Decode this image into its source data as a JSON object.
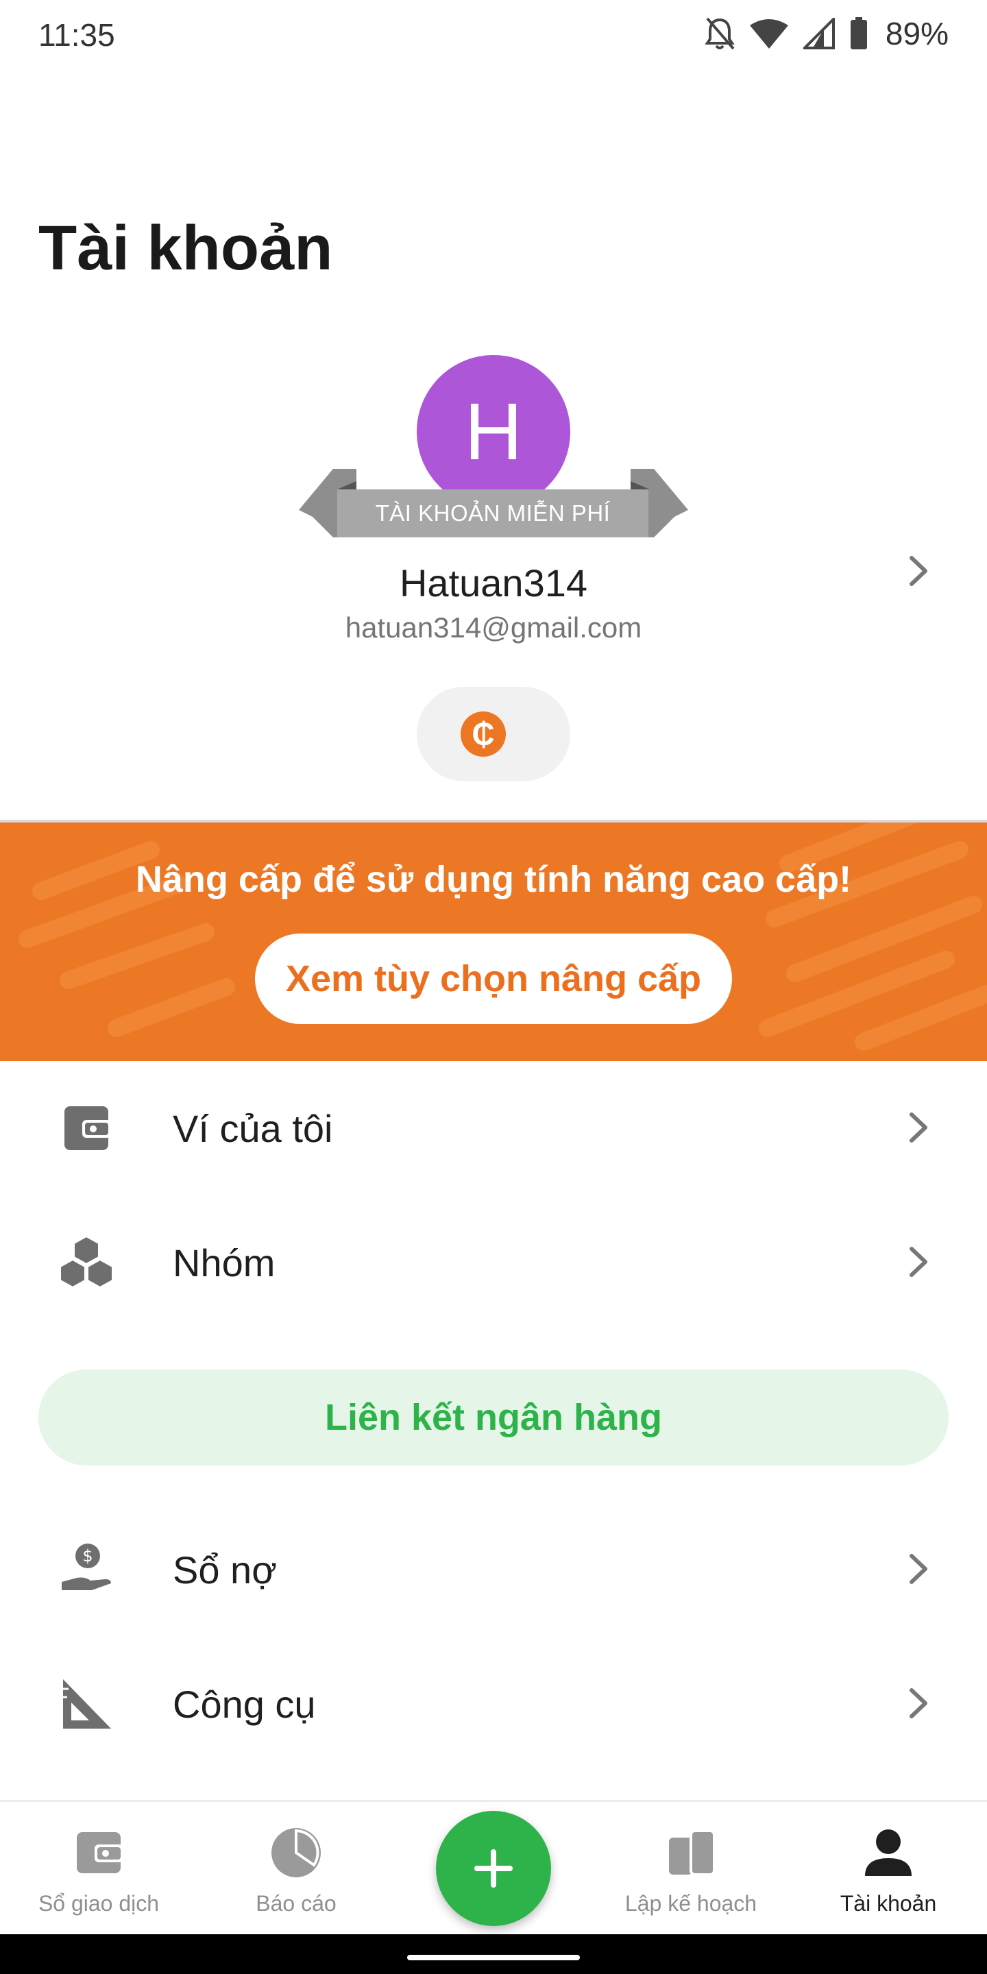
{
  "status_bar": {
    "time": "11:35",
    "battery": "89%",
    "icons": [
      "notifications-off-icon",
      "wifi-icon",
      "signal-icon",
      "battery-icon"
    ]
  },
  "page": {
    "title": "Tài khoản"
  },
  "profile": {
    "avatar_initial": "H",
    "avatar_color": "#ad56d8",
    "badge": "TÀI KHOẢN MIỄN PHÍ",
    "username": "Hatuan314",
    "email": "hatuan314@gmail.com",
    "credit_icon": "coin-icon"
  },
  "upgrade": {
    "text": "Nâng cấp để sử dụng tính năng cao cấp!",
    "button": "Xem tùy chọn nâng cấp",
    "color": "#ec7825"
  },
  "menu": {
    "items": [
      {
        "label": "Ví của tôi",
        "icon": "wallet-icon"
      },
      {
        "label": "Nhóm",
        "icon": "boxes-icon"
      }
    ],
    "bank_link": "Liên kết ngân hàng",
    "items2": [
      {
        "label": "Sổ nợ",
        "icon": "debt-hand-icon"
      },
      {
        "label": "Công cụ",
        "icon": "ruler-triangle-icon"
      }
    ]
  },
  "bottom_nav": {
    "items": [
      {
        "label": "Sổ giao dịch",
        "icon": "wallet-icon"
      },
      {
        "label": "Báo cáo",
        "icon": "pie-chart-icon"
      },
      {
        "label": "Lập kế hoạch",
        "icon": "planning-icon"
      },
      {
        "label": "Tài khoản",
        "icon": "person-icon",
        "active": true
      }
    ],
    "fab_icon": "plus-icon",
    "accent": "#2db34a"
  }
}
